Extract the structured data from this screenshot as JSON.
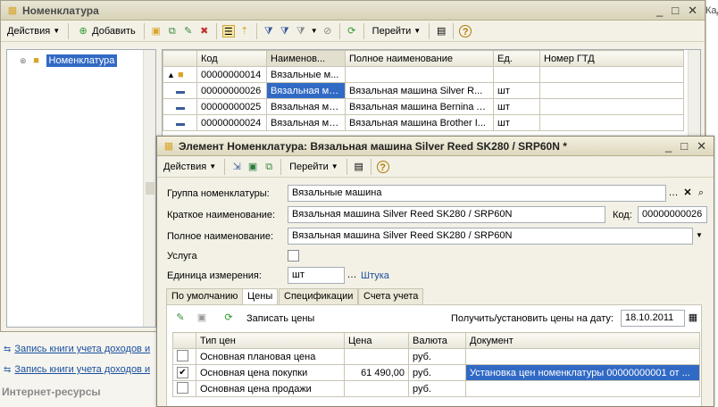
{
  "right_edge": {
    "label1": "Кад",
    "label2": "…"
  },
  "main_window": {
    "title": "Номенклатура",
    "toolbar": {
      "actions": "Действия",
      "add": "Добавить",
      "goto": "Перейти"
    },
    "tree_root": "Номенклатура",
    "columns": [
      "Код",
      "Наименов...",
      "Полное наименование",
      "Ед.",
      "Номер ГТД"
    ],
    "rows": [
      {
        "code": "00000000014",
        "name": "Вязальные м...",
        "full": "",
        "unit": "",
        "gtd": ""
      },
      {
        "code": "00000000026",
        "name": "Вязальная маши...",
        "full": "Вязальная машина  Silver R...",
        "unit": "шт",
        "gtd": ""
      },
      {
        "code": "00000000025",
        "name": "Вязальная маши...",
        "full": "Вязальная машина Bernina A...",
        "unit": "шт",
        "gtd": ""
      },
      {
        "code": "00000000024",
        "name": "Вязальная маши...",
        "full": "Вязальная машина Brother I...",
        "unit": "шт",
        "gtd": ""
      }
    ]
  },
  "left_links": [
    "Запись книги учета доходов и",
    "Запись книги учета доходов и"
  ],
  "left_section": "Интернет-ресурсы",
  "element_window": {
    "title": "Элемент Номенклатура: Вязальная машина  Silver Reed SK280 / SRP60N *",
    "toolbar": {
      "actions": "Действия",
      "goto": "Перейти"
    },
    "group_label": "Группа номенклатуры:",
    "group_value": "Вязальные машина",
    "short_label": "Краткое наименование:",
    "short_value": "Вязальная машина   Silver Reed SK280 / SRP60N",
    "code_label": "Код:",
    "code_value": "00000000026",
    "full_label": "Полное наименование:",
    "full_value": "Вязальная машина   Silver Reed SK280 / SRP60N",
    "service_label": "Услуга",
    "unit_label": "Единица измерения:",
    "unit_value": "шт",
    "unit_link": "Штука",
    "tabs": [
      "По умолчанию",
      "Цены",
      "Спецификации",
      "Счета учета"
    ],
    "prices_toolbar": {
      "write": "Записать цены",
      "date_label": "Получить/установить цены на дату:",
      "date_value": "18.10.2011"
    },
    "price_columns": [
      "Тип цен",
      "Цена",
      "Валюта",
      "Документ"
    ],
    "price_rows": [
      {
        "checked": false,
        "type": "Основная плановая цена",
        "price": "",
        "currency": "руб.",
        "doc": ""
      },
      {
        "checked": true,
        "type": "Основная цена покупки",
        "price": "61 490,00",
        "currency": "руб.",
        "doc": "Установка цен номенклатуры 00000000001 от ..."
      },
      {
        "checked": false,
        "type": "Основная цена продажи",
        "price": "",
        "currency": "руб.",
        "doc": ""
      }
    ]
  },
  "colors": {
    "selection": "#316ac5",
    "title_gradient": "#d8d3b8",
    "link": "#1a4fa0"
  }
}
